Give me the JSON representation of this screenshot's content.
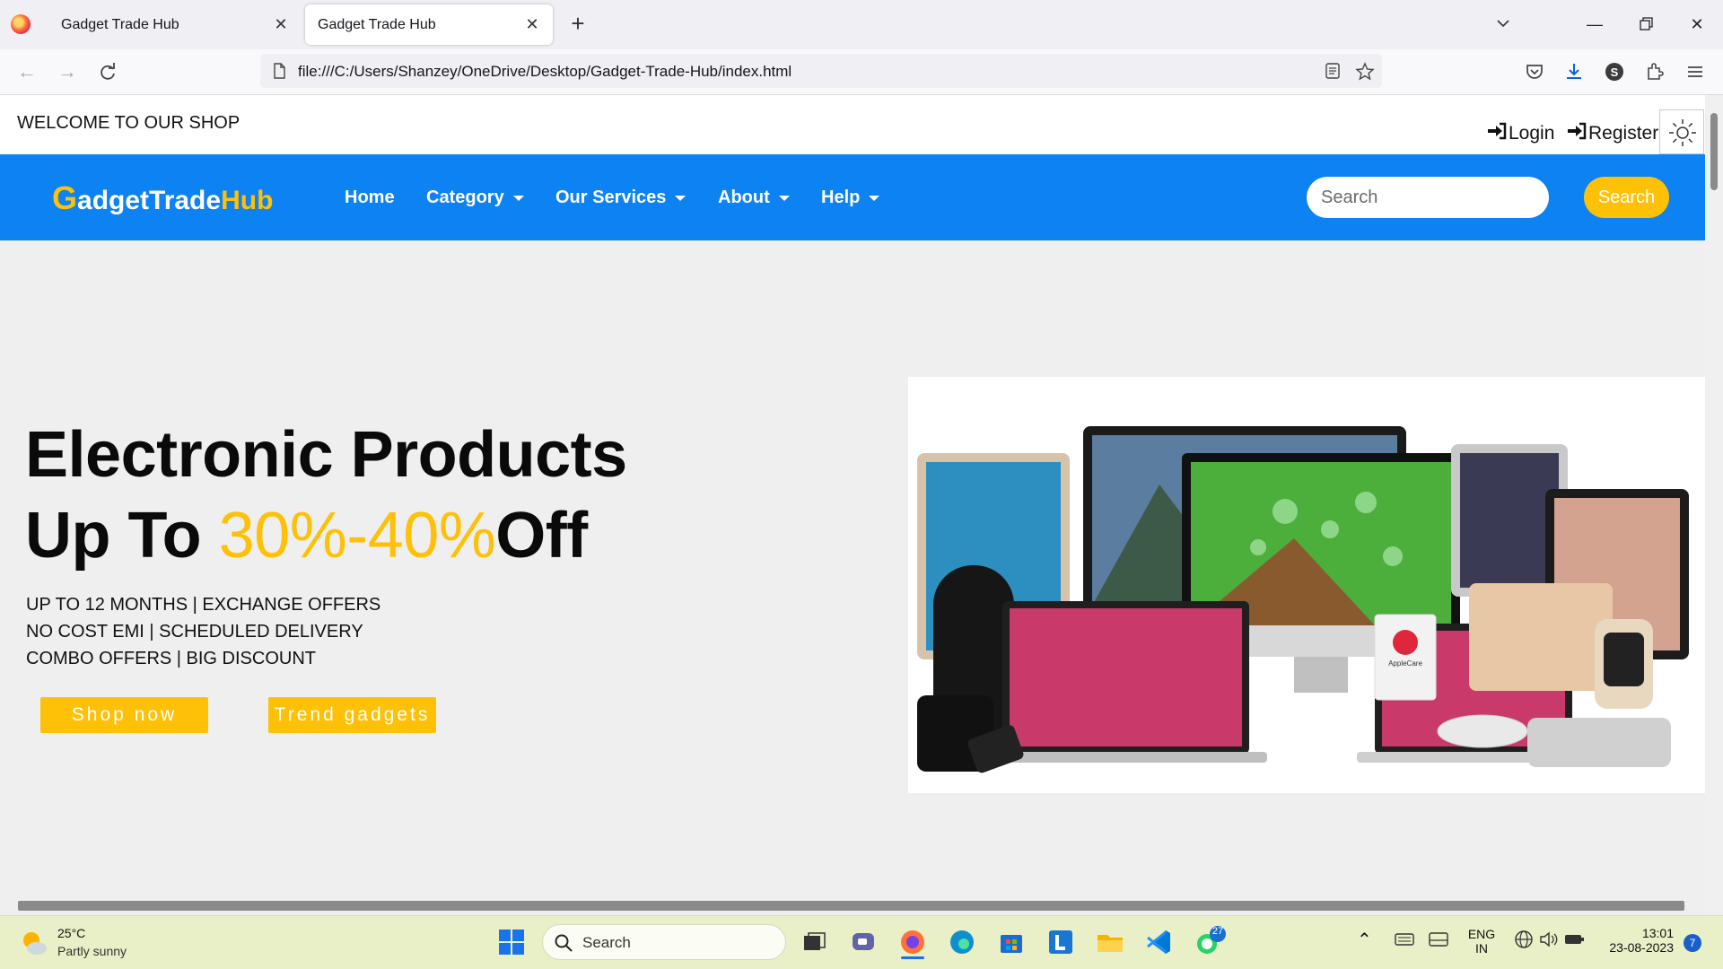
{
  "browser": {
    "tabs": [
      {
        "title": "Gadget Trade Hub"
      },
      {
        "title": "Gadget Trade Hub"
      }
    ],
    "url": "file:///C:/Users/Shanzey/OneDrive/Desktop/Gadget-Trade-Hub/index.html",
    "profile_initial": "S"
  },
  "site": {
    "welcome": "WELCOME TO OUR SHOP",
    "login": "Login",
    "register": "Register",
    "brand": {
      "g": "G",
      "adget": "adget",
      "trade": "Trade",
      "hub": "Hub"
    },
    "menu": [
      {
        "label": "Home"
      },
      {
        "label": "Category"
      },
      {
        "label": "Our Services"
      },
      {
        "label": "About"
      },
      {
        "label": "Help"
      }
    ],
    "search_placeholder": "Search",
    "search_button": "Search",
    "hero": {
      "line1": "Electronic Products",
      "line2_prefix": "Up To ",
      "line2_pct": "30%-40%",
      "line2_suffix": "Off",
      "bullets": [
        "UP TO 12 MONTHS | EXCHANGE OFFERS",
        "NO COST EMI | SCHEDULED DELIVERY",
        "COMBO OFFERS | BIG DISCOUNT"
      ],
      "shop_now": "Shop now",
      "trend_gadgets": "Trend gadgets",
      "image_badge": "AppleCare"
    }
  },
  "taskbar": {
    "weather": {
      "temp": "25°C",
      "desc": "Partly sunny"
    },
    "search_label": "Search",
    "whatsapp_badge": "27",
    "language": {
      "l1": "ENG",
      "l2": "IN"
    },
    "time": "13:01",
    "date": "23-08-2023",
    "notification_count": "7"
  },
  "colors": {
    "brand_blue": "#0d82f2",
    "accent_yellow": "#ffc107"
  }
}
